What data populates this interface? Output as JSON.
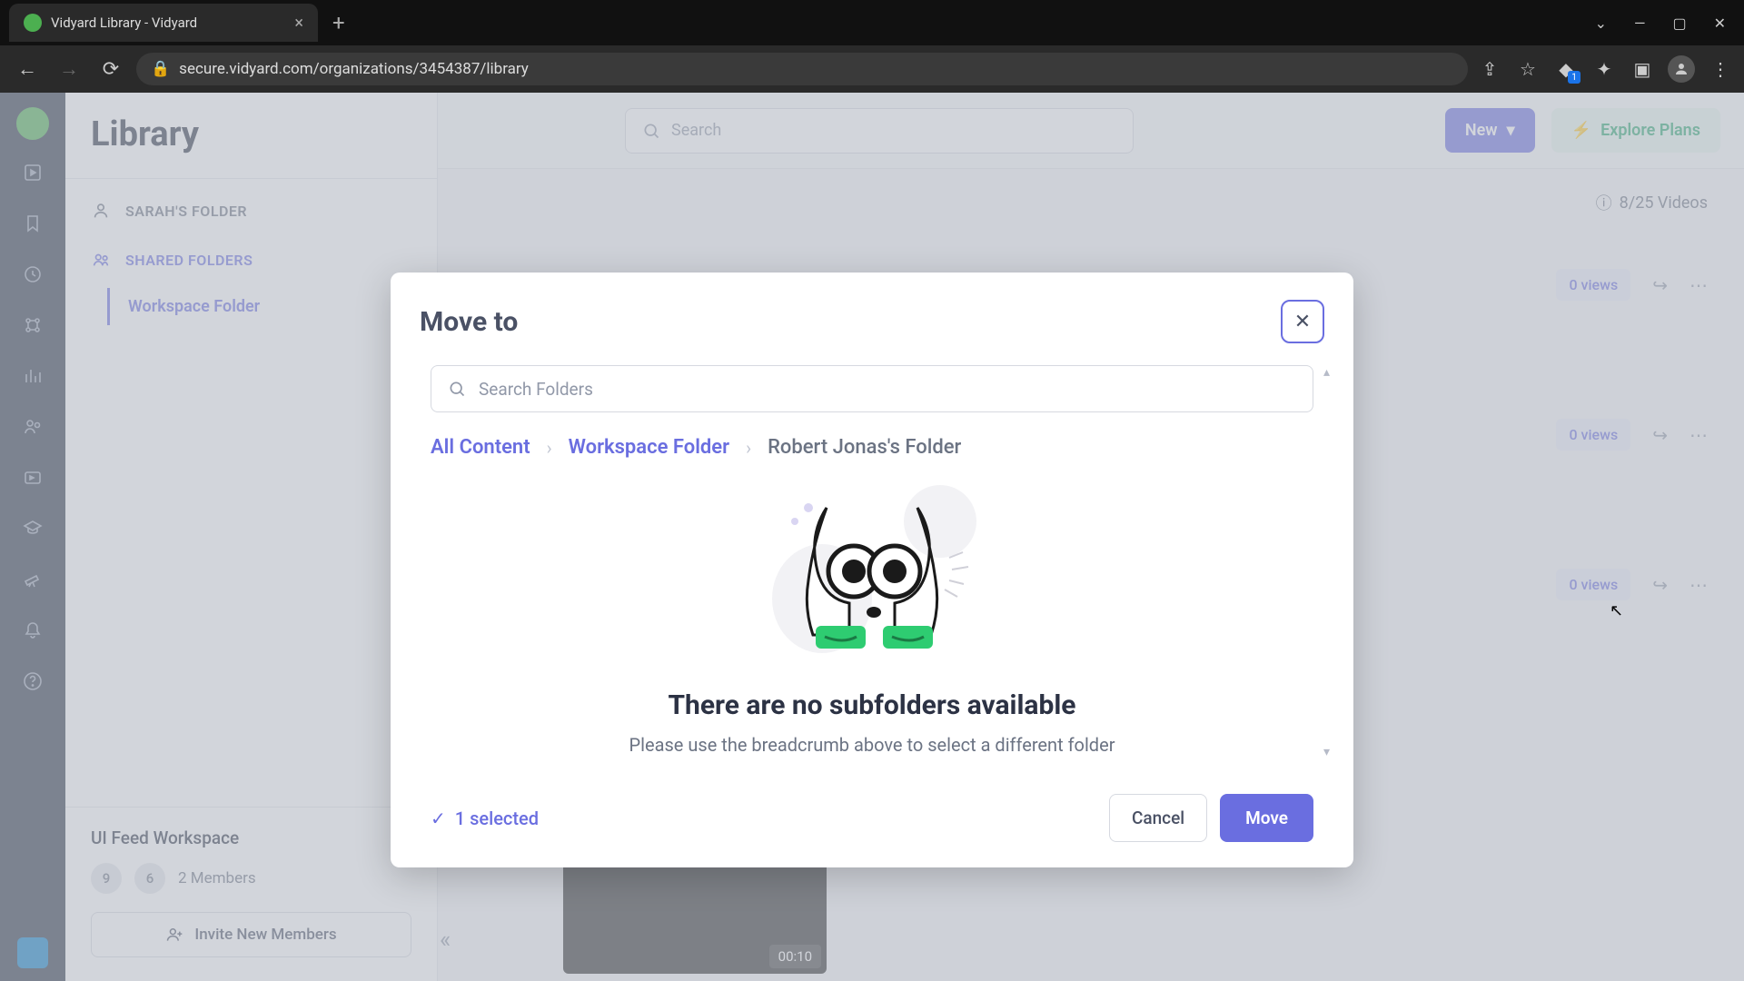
{
  "browser": {
    "tab_title": "Vidyard Library - Vidyard",
    "url": "secure.vidyard.com/organizations/3454387/library"
  },
  "header": {
    "title": "Library",
    "search_placeholder": "Search",
    "new_button": "New",
    "explore_button": "Explore Plans",
    "videos_count": "8/25 Videos"
  },
  "sidebar": {
    "personal_section": "SARAH'S FOLDER",
    "shared_section": "SHARED FOLDERS",
    "workspace_folder": "Workspace Folder",
    "workspace_name": "UI Feed Workspace",
    "member_badges": [
      "9",
      "6"
    ],
    "members_text": "2 Members",
    "invite_label": "Invite New Members"
  },
  "rows": {
    "views": "0 views"
  },
  "clip": {
    "duration": "00:10"
  },
  "modal": {
    "title": "Move to",
    "search_placeholder": "Search Folders",
    "breadcrumb": [
      "All Content",
      "Workspace Folder",
      "Robert Jonas's Folder"
    ],
    "empty_title": "There are no subfolders available",
    "empty_sub": "Please use the breadcrumb above to select a different folder",
    "selected_text": "1 selected",
    "cancel": "Cancel",
    "move": "Move"
  }
}
